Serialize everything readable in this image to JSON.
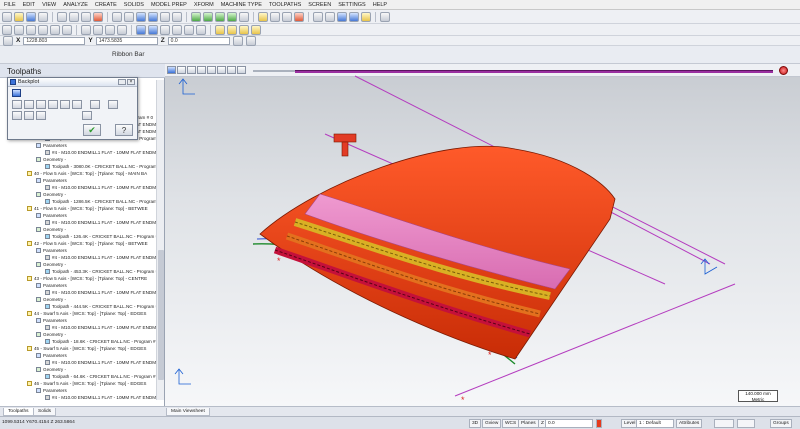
{
  "menu": [
    "FILE",
    "EDIT",
    "VIEW",
    "ANALYZE",
    "CREATE",
    "SOLIDS",
    "MODEL PREP",
    "XFORM",
    "MACHINE TYPE",
    "TOOLPATHS",
    "SCREEN",
    "SETTINGS",
    "HELP"
  ],
  "coords": {
    "x_label": "X",
    "x_value": "1228.803",
    "y_label": "Y",
    "y_value": "1473.5835",
    "z_label": "Z",
    "z_value": "0.0"
  },
  "ribbon_label": "Ribbon Bar",
  "panel_title": "Toolpaths",
  "dialog": {
    "title": "Backplot",
    "ok_symbol": "✔",
    "help_symbol": "?"
  },
  "tree_rows": [
    "Toolpath - 2K - CRICKET BALL.NC - Program # 0",
    "#4 - M10.00 ENDMILL1 FLAT - 10MM FLAT ENDMILL",
    "#4 - M10.00 ENDMILL1 FLAT - 10MM FLAT ENDMILL",
    "Toolpath - 3080.0K - CRICKET BALL.NC - Program # 0",
    "Parameters",
    "#4 - M10.00 ENDMILL1 FLAT - 10MM FLAT ENDMILL",
    "Geometry -",
    "Toolpath - 3080.0K - CRICKET BALL.NC - Program # 0",
    "40 - Flow 5 Axis - [WCS: Top] - [Tplane: Top] - MAIN BA",
    "Parameters",
    "#4 - M10.00 ENDMILL1 FLAT - 10MM FLAT ENDMILL",
    "Geometry -",
    "Toolpath - 1286.5K - CRICKET BALL.NC - Program # 0",
    "41 - Flow 5 Axis - [WCS: Top] - [Tplane: Top] - BETWEE",
    "Parameters",
    "#4 - M10.00 ENDMILL1 FLAT - 10MM FLAT ENDMILL",
    "Geometry -",
    "Toolpath - 126.4K - CRICKET BALL.NC - Program # 0",
    "42 - Flow 5 Axis - [WCS: Top] - [Tplane: Top] - BETWEE",
    "Parameters",
    "#4 - M10.00 ENDMILL1 FLAT - 10MM FLAT ENDMILL",
    "Geometry -",
    "Toolpath - 453.3K - CRICKET BALL.NC - Program # 0",
    "43 - Flow 5 Axis - [WCS: Top] - [Tplane: Top] - CENTRE",
    "Parameters",
    "#4 - M10.00 ENDMILL1 FLAT - 10MM FLAT ENDMILL",
    "Geometry -",
    "Toolpath - 444.5K - CRICKET BALL.NC - Program # 0",
    "44 - Swarf 5 Axis - [WCS: Top] - [Tplane: Top] - EDGES",
    "Parameters",
    "#4 - M10.00 ENDMILL1 FLAT - 10MM FLAT ENDMILL",
    "Geometry -",
    "Toolpath - 18.6K - CRICKET BALL.NC - Program # 0",
    "45 - Swarf 5 Axis - [WCS: Top] - [Tplane: Top] - EDGES",
    "Parameters",
    "#4 - M10.00 ENDMILL1 FLAT - 10MM FLAT ENDMILL",
    "Geometry -",
    "Toolpath - 64.6K - CRICKET BALL.NC - Program # 0",
    "46 - Swarf 5 Axis - [WCS: Top] - [Tplane: Top] - EDGES",
    "Parameters",
    "#4 - M10.00 ENDMILL1 FLAT - 10MM FLAT ENDMILL"
  ],
  "viewport": {
    "scale_value": "140.000 mm",
    "scale_unit": "Metric"
  },
  "tabs": {
    "left1": "Toolpaths",
    "left2": "Solids",
    "viewsheet": "Main Viewsheet"
  },
  "status": {
    "coords": "1099.5314   Y670.4154   Z 263.5864",
    "b3d": "3D",
    "gview": "Gview",
    "wcs": "WCS",
    "planes": "Planes",
    "z_label": "Z",
    "z_value": "0.0",
    "level_label": "Level",
    "level_value": "1 : Default",
    "attributes": "Attributes",
    "groups": "Groups"
  }
}
